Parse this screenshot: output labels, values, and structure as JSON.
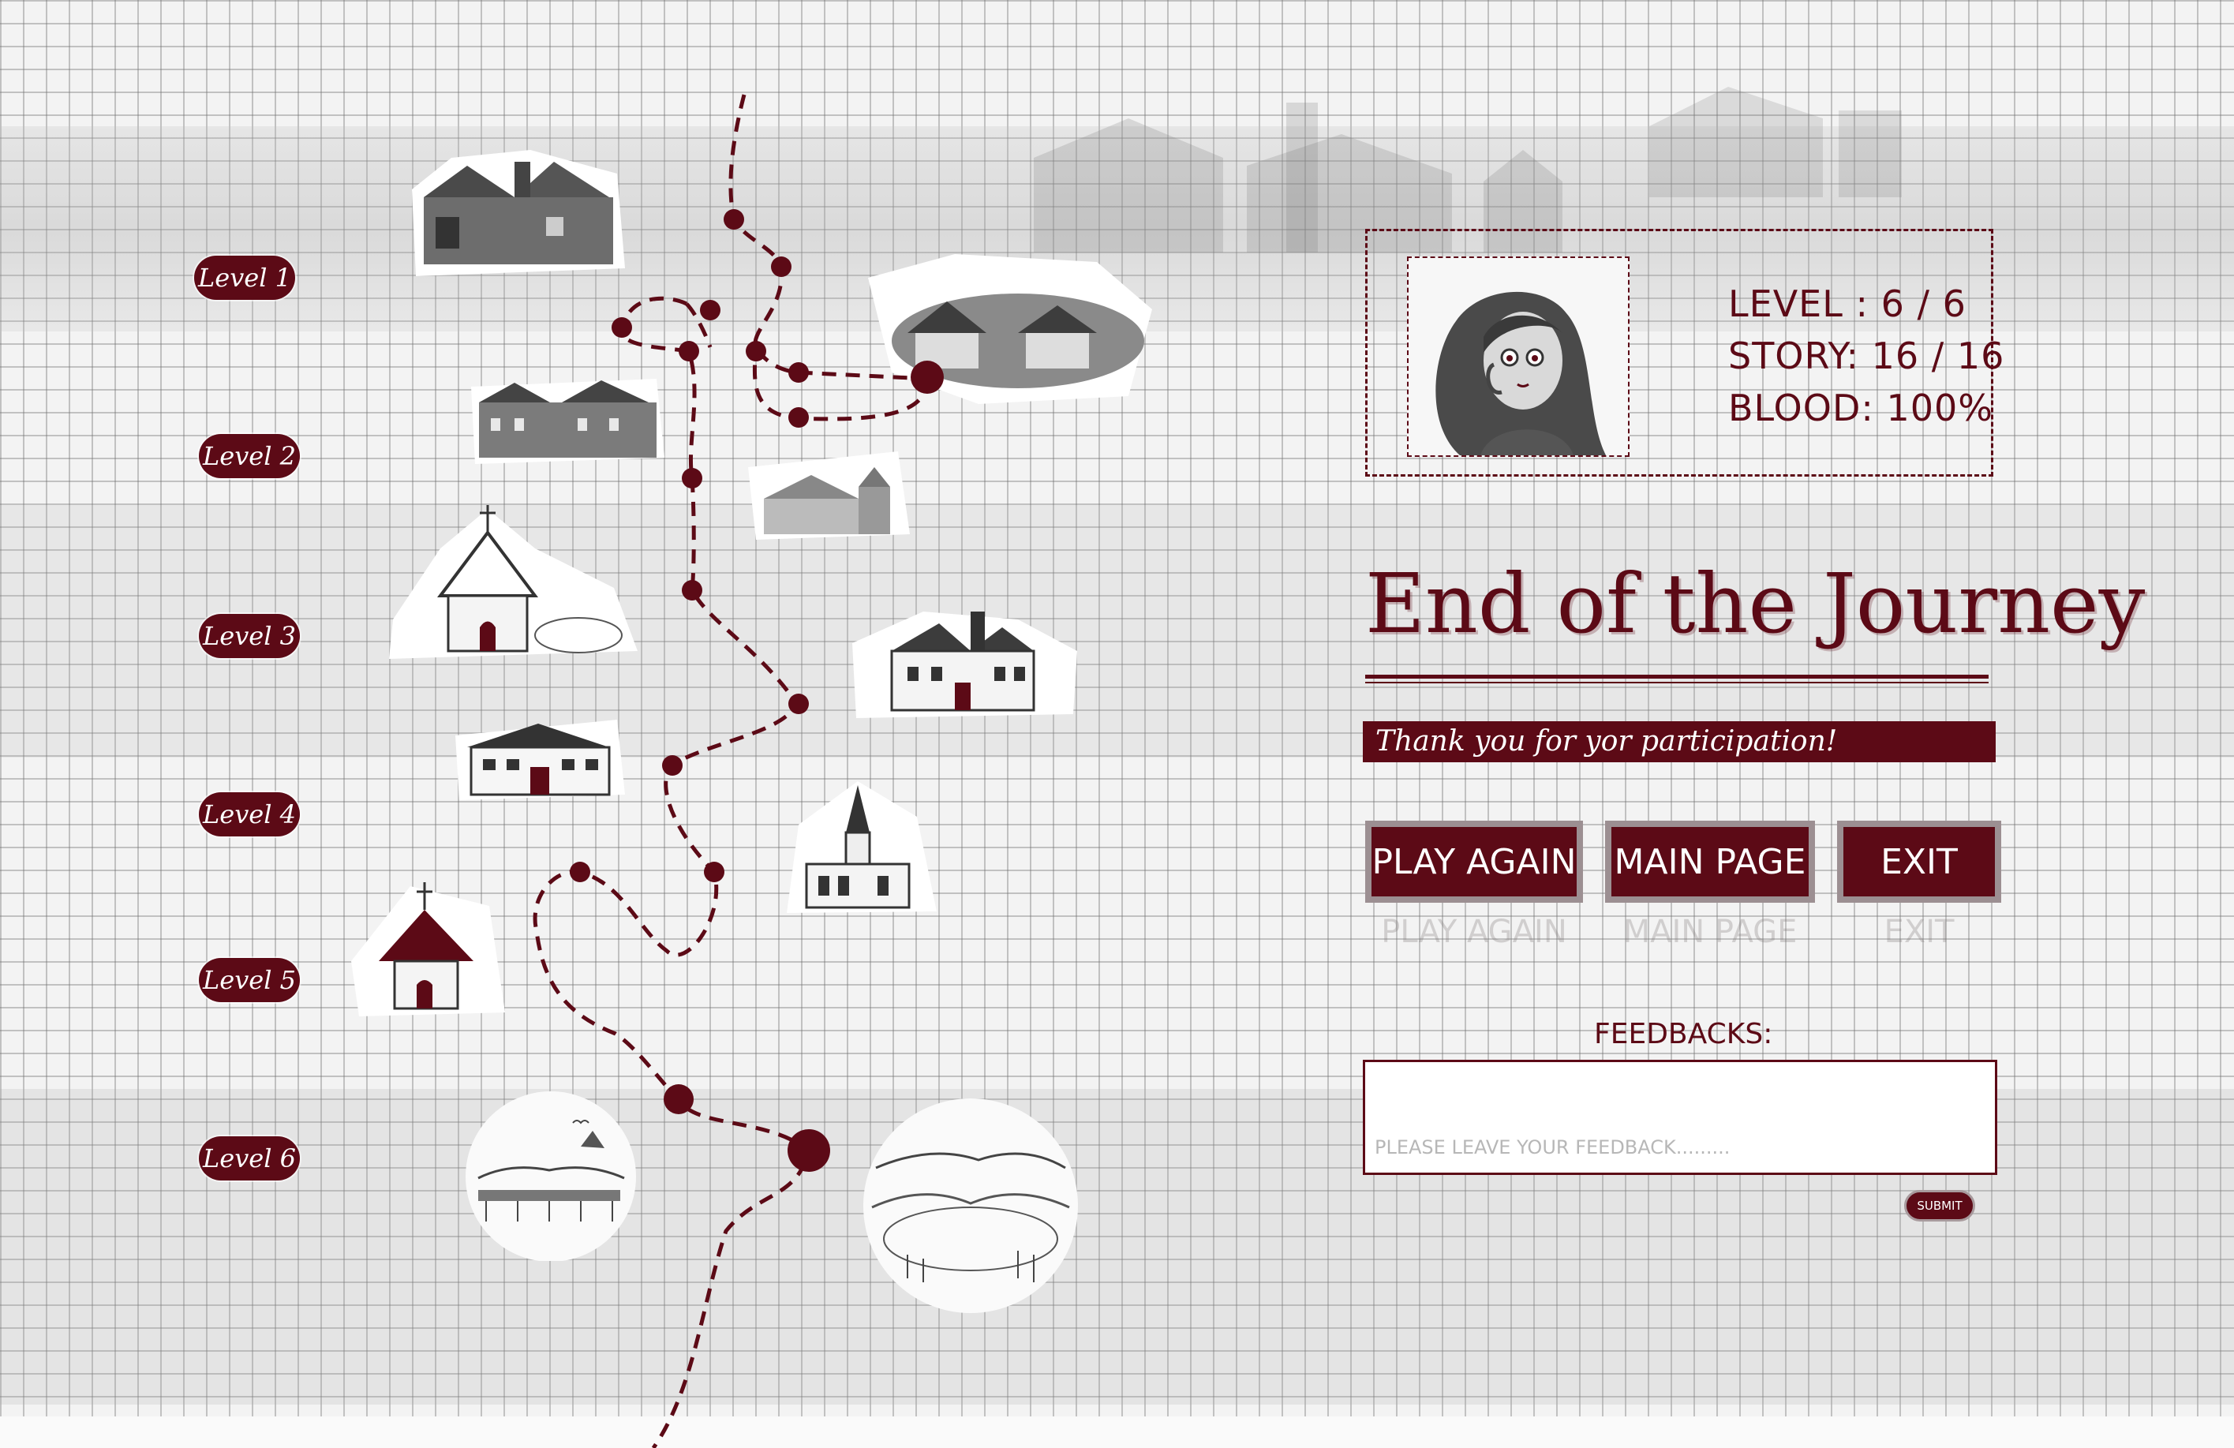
{
  "levels": [
    "Level 1",
    "Level 2",
    "Level 3",
    "Level 4",
    "Level 5",
    "Level 6"
  ],
  "stats": {
    "level": "LEVEL : 6 / 6",
    "story": "STORY: 16 / 16",
    "blood": "BLOOD: 100%"
  },
  "title": "End of the Journey",
  "thanks": "Thank you for yor participation!",
  "buttons": {
    "play_again": "PLAY AGAIN",
    "main_page": "MAIN PAGE",
    "exit": "EXIT"
  },
  "feedback": {
    "label": "FEEDBACKS:",
    "placeholder": "PLEASE LEAVE YOUR FEEDBACK.........",
    "submit": "SUBMIT"
  },
  "colors": {
    "accent": "#5c0a16",
    "grid": "#6e6e6e",
    "paper": "#f3f3f3"
  }
}
